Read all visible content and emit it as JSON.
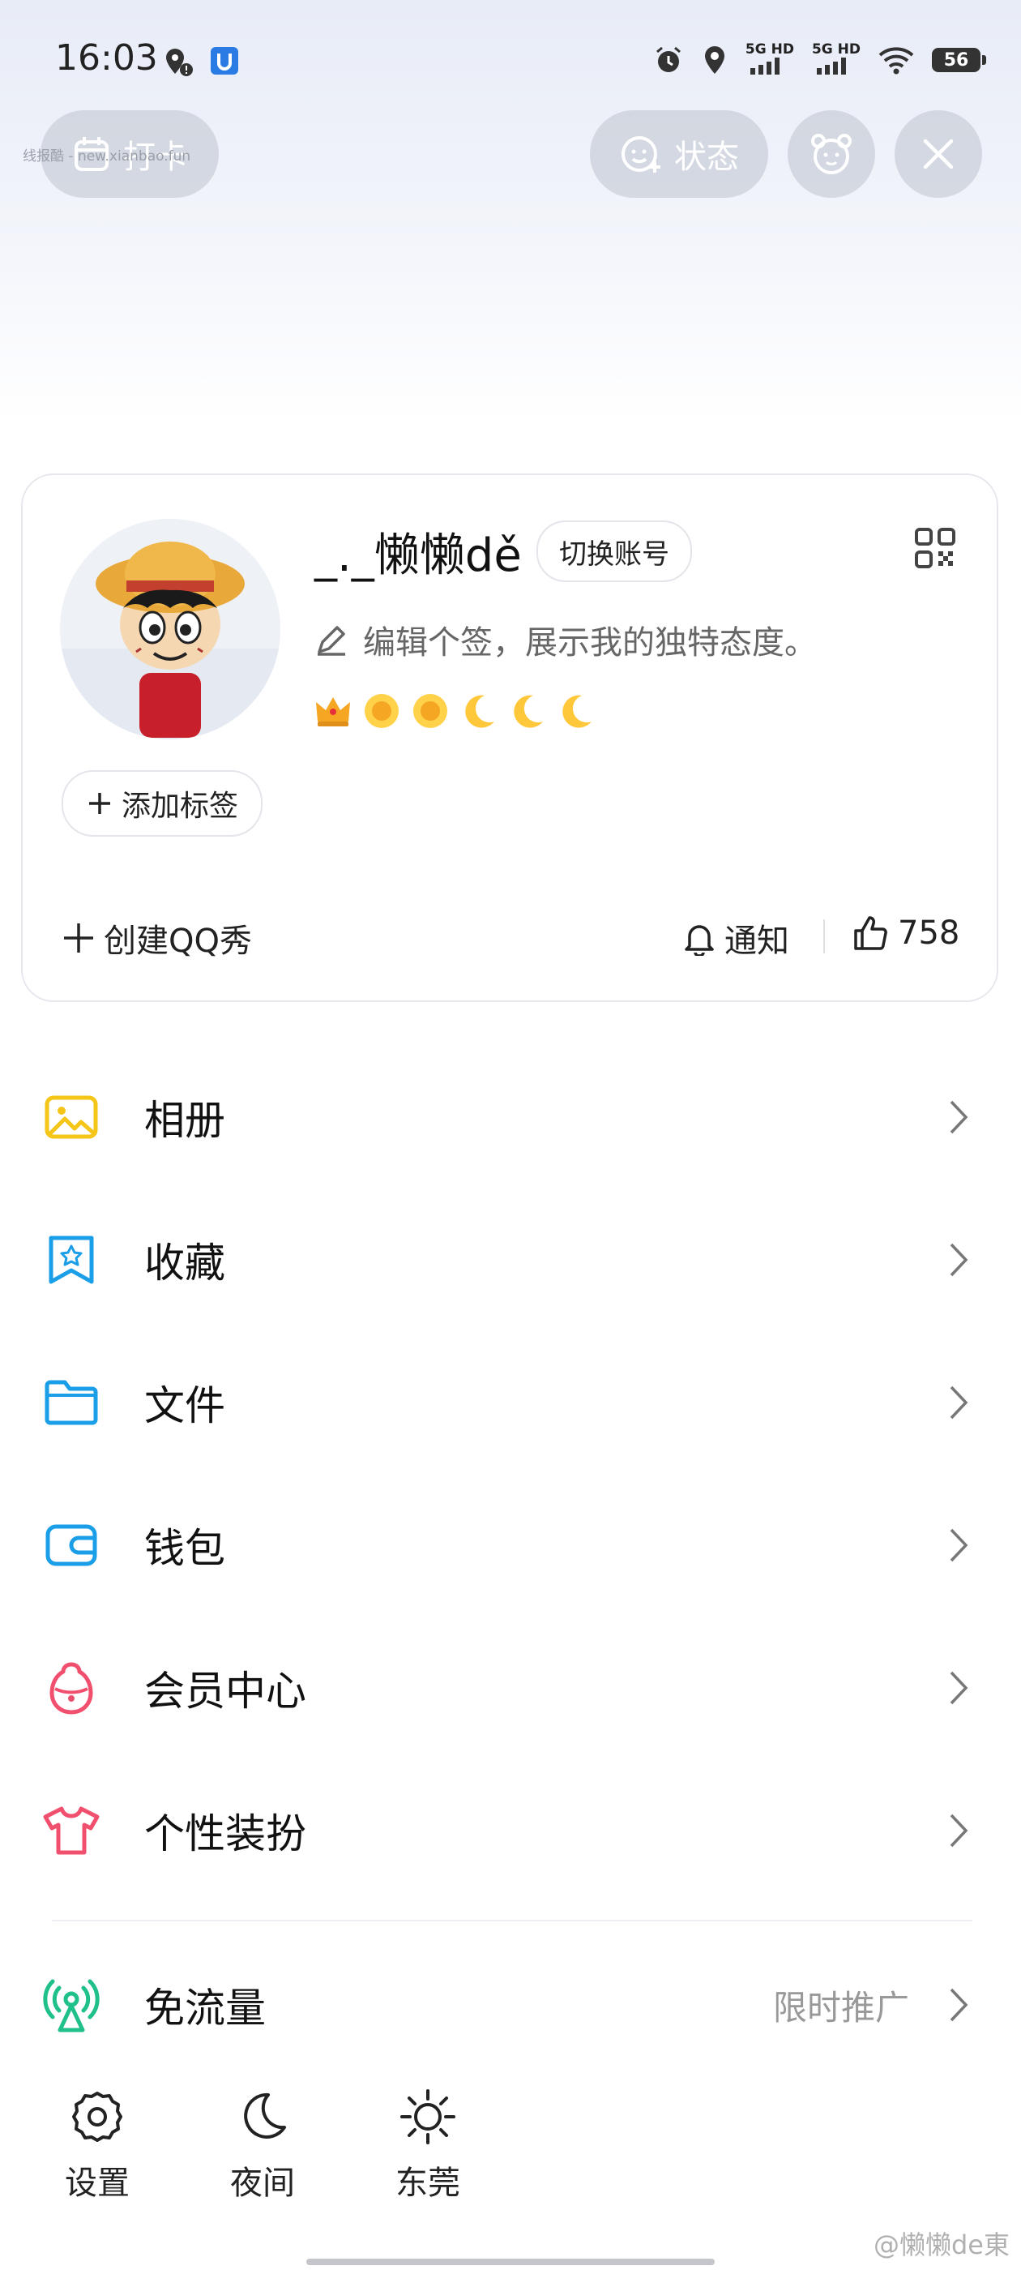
{
  "status_bar": {
    "time": "16:03",
    "net1": "5G HD",
    "net2": "5G HD",
    "battery": "56"
  },
  "top_bar": {
    "checkin_label": "打卡",
    "status_label": "状态",
    "watermark": "线报酷 - new.xianbao.fun"
  },
  "profile": {
    "nickname": "_._懒懒dě",
    "switch_account": "切换账号",
    "signature_placeholder": "编辑个签，展示我的独特态度。",
    "add_tag": "添加标签",
    "create_qq_show": "创建QQ秀",
    "notify_label": "通知",
    "likes": "758",
    "level_icons": [
      "crown",
      "sun",
      "sun",
      "moon",
      "moon",
      "moon"
    ]
  },
  "menu": {
    "items": [
      {
        "label": "相册",
        "icon": "album-icon",
        "color": "#f5c518"
      },
      {
        "label": "收藏",
        "icon": "favorites-icon",
        "color": "#1a9ee8"
      },
      {
        "label": "文件",
        "icon": "folder-icon",
        "color": "#1a9ee8"
      },
      {
        "label": "钱包",
        "icon": "wallet-icon",
        "color": "#1a9ee8"
      },
      {
        "label": "会员中心",
        "icon": "vip-icon",
        "color": "#f0506e"
      },
      {
        "label": "个性装扮",
        "icon": "tshirt-icon",
        "color": "#f0506e"
      }
    ],
    "free_traffic": {
      "label": "免流量",
      "hint": "限时推广",
      "color": "#1fc08a"
    }
  },
  "bottom": {
    "settings": "设置",
    "night": "夜间",
    "city": "东莞"
  },
  "credit": "@懒懒de東"
}
